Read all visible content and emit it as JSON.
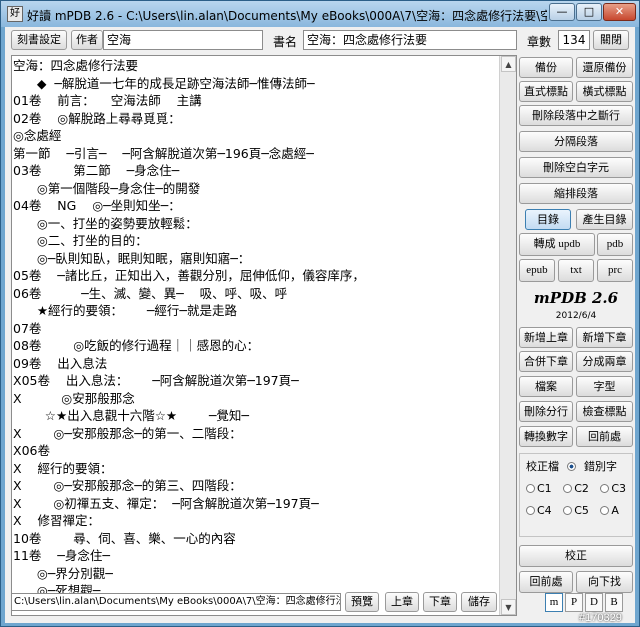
{
  "window": {
    "app_icon_glyph": "好",
    "title": "好讀 mPDB 2.6 - C:\\Users\\lin.alan\\Documents\\My eBooks\\000A\\7\\空海：四念處修行法要\\空海：四念處修行法...",
    "minimize_glyph": "—",
    "maximize_glyph": "□",
    "close_glyph": "✕"
  },
  "topbar": {
    "book_settings_label": "刻書設定",
    "author_label": "作者",
    "author_value": "空海",
    "title_label": "書名",
    "title_value": "空海：四念處修行法要",
    "chapter_count_label": "章數",
    "chapter_count_value": "134",
    "close_button_label": "關閉"
  },
  "editor": {
    "lines": [
      "空海：四念處修行法要",
      "      ◆  ─解脫道一七年的成長足跡空海法師─惟傳法師─",
      "01卷    前言：    空海法師    主講",
      "02卷    ◎解脫路上尋尋覓覓：",
      "◎念處經",
      "第一節    ─引言─    ─阿含解脫道次第─196頁─念處經─",
      "03卷        第二節    ─身念住─",
      "      ◎第一個階段─身念住─的開發",
      "04卷    NG    ◎─坐則知坐─：",
      "      ◎一、打坐的姿勢要放輕鬆：",
      "      ◎二、打坐的目的：",
      "      ◎─臥則知臥，眠則知眠，寤則知寤─：",
      "05卷    ─諸比丘，正知出入，善觀分別，屈伸低仰，儀容庠序，",
      "06卷          ─生、滅、變、異─    吸、呼、吸、呼",
      "      ★經行的要領：      ─經行─就是走路",
      "07卷",
      "08卷        ◎吃飯的修行過程｜｜感恩的心：",
      "09卷    出入息法",
      "X05卷    出入息法：      ─阿含解脫道次第─197頁─",
      "X          ◎安那般那念",
      "        ☆★出入息觀十六階☆★        ─覺知─",
      "X        ◎─安那般那念─的第一、二階段：",
      "X06卷",
      "X    經行的要領：",
      "X        ◎─安那般那念─的第三、四階段：",
      "X        ◎初禪五支、禪定：  ─阿含解脫道次第─197頁─",
      "X    修習禪定：",
      "10卷        尋、伺、喜、樂、一心的內容",
      "11卷    ─身念住─",
      "      ◎─界分別觀─",
      "      ◎─死想觀─"
    ],
    "scroll_up_glyph": "▲",
    "scroll_down_glyph": "▼"
  },
  "side": {
    "backup": "備份",
    "restore_backup": "還原備份",
    "h_punct": "直式標點",
    "v_punct": "橫式標點",
    "remove_para_break": "刪除段落中之斷行",
    "split_para": "分隔段落",
    "remove_blank": "刪除空白字元",
    "reflow": "縮排段落",
    "toc": "目錄",
    "gen_toc": "產生目錄",
    "to_updb": "轉成 updb",
    "pdb": "pdb",
    "epub": "epub",
    "txt": "txt",
    "prc": "prc",
    "brand": "mPDB 2.6",
    "brand_date": "2012/6/4",
    "add_chapter_up": "新增上章",
    "add_chapter_down": "新增下章",
    "merge_down": "合併下章",
    "split_chapter": "分成兩章",
    "file": "檔案",
    "font": "字型",
    "delete_line": "刪除分行",
    "check_punct": "檢查標點",
    "convert_digits": "轉換數字",
    "back": "回前處",
    "proof_label": "校正檔",
    "typo_label": "錯別字",
    "c1": "C1",
    "c2": "C2",
    "c3": "C3",
    "c4": "C4",
    "c5": "C5",
    "a": "A",
    "proofread": "校正",
    "prev_place": "回前處",
    "find_next": "向下找"
  },
  "bottom": {
    "status_path": "C:\\Users\\lin.alan\\Documents\\My eBooks\\000A\\7\\空海：四念處修行法要\\0.txt",
    "preview": "預覽",
    "prev_chapter": "上章",
    "next_chapter": "下章",
    "save": "儲存",
    "toggle_m": "m",
    "toggle_p": "P",
    "toggle_d": "D",
    "toggle_b": "B"
  },
  "watermark": "#170329",
  "colors": {
    "title_bar": "#8ab7dd",
    "toc_active": "#cfe3f7"
  }
}
